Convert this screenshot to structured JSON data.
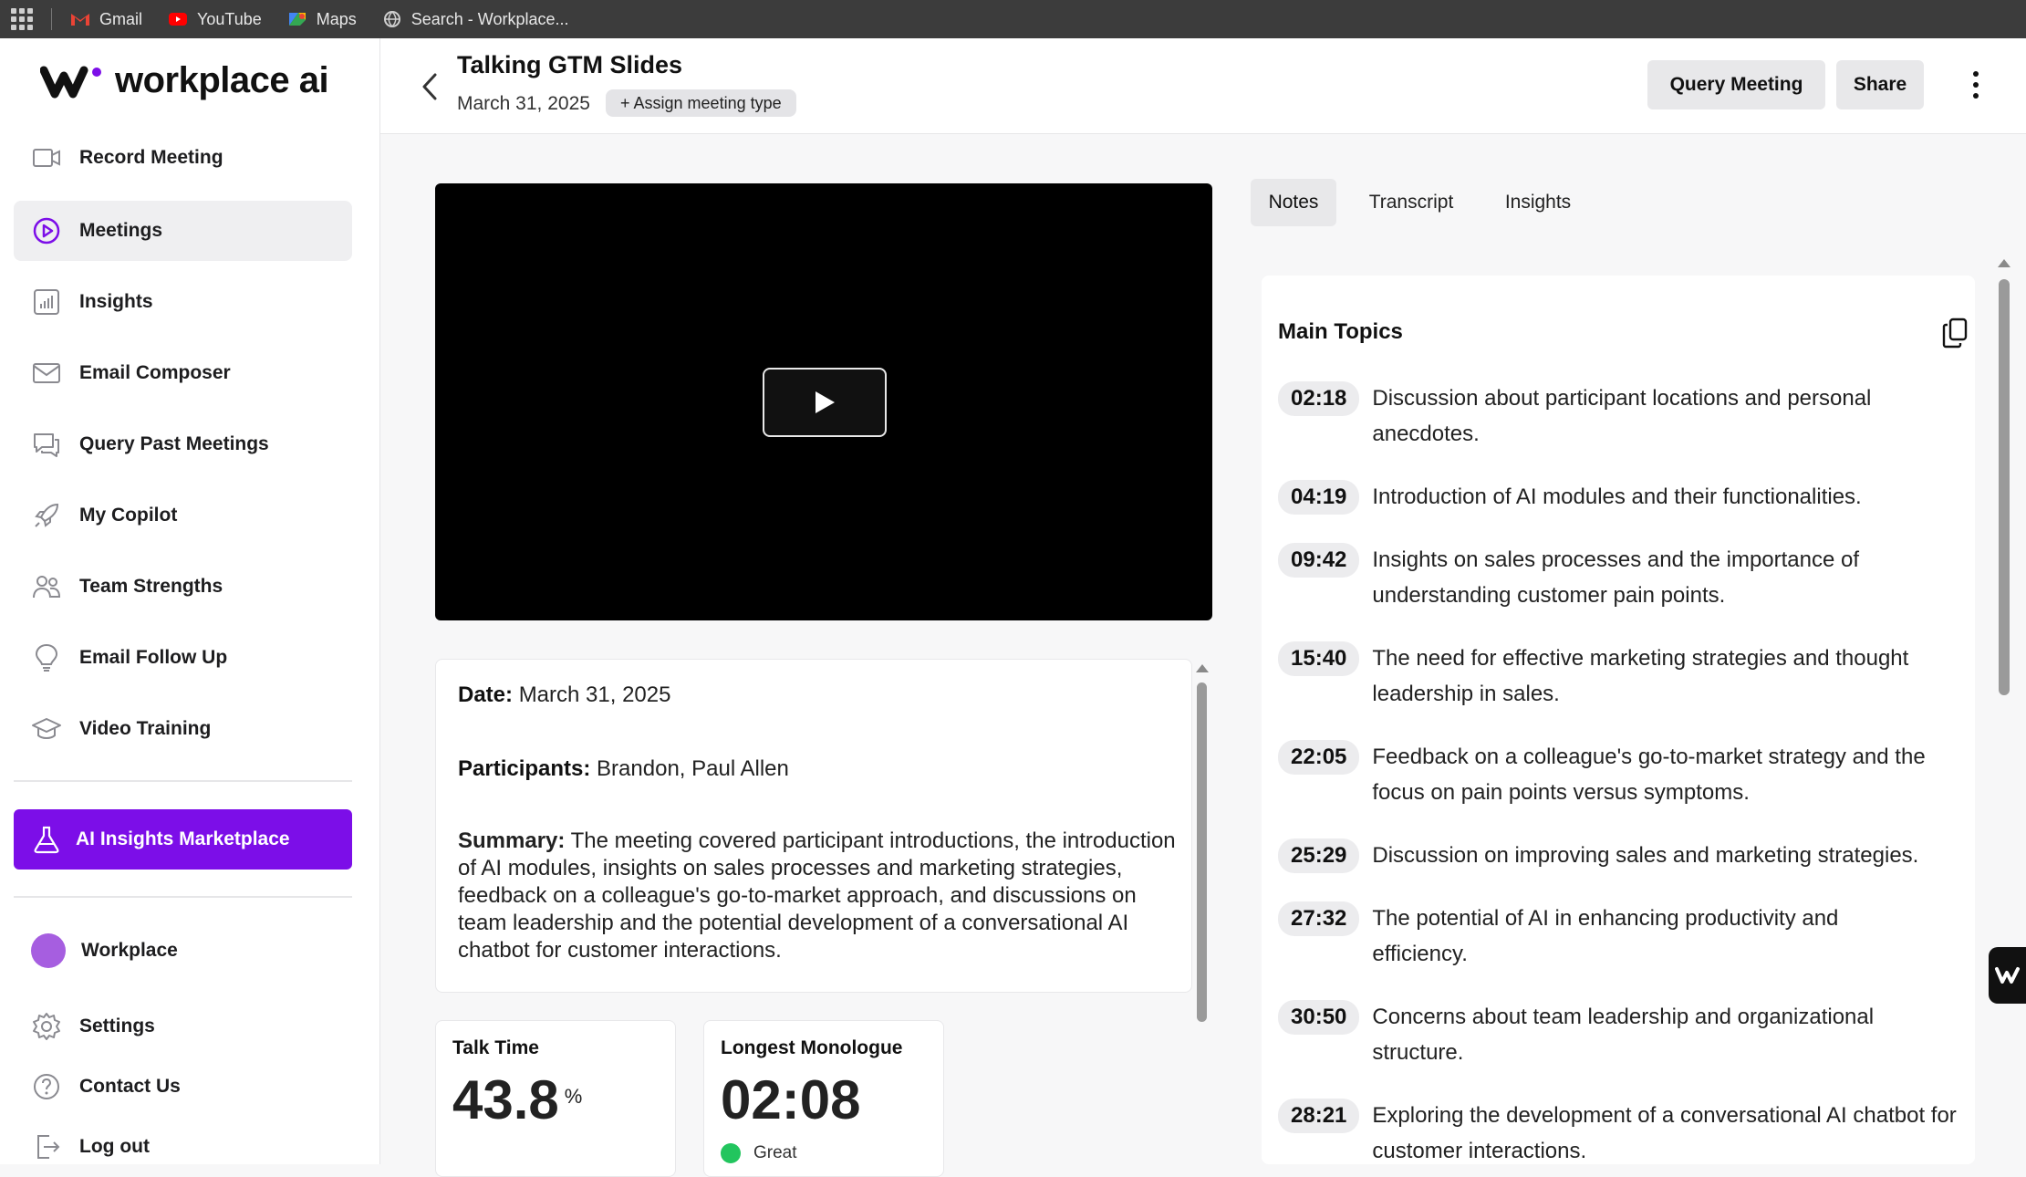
{
  "browser": {
    "bookmarks": [
      {
        "label": "Gmail",
        "icon": "gmail-icon",
        "color": "#ea4335"
      },
      {
        "label": "YouTube",
        "icon": "youtube-icon",
        "color": "#ff0000"
      },
      {
        "label": "Maps",
        "icon": "maps-icon",
        "color": "#34a853"
      },
      {
        "label": "Search - Workplace...",
        "icon": "globe-icon",
        "color": "#cfcfcf"
      }
    ]
  },
  "brand": {
    "name": "workplace ai",
    "accent": "#7c0ee8"
  },
  "sidebar": {
    "items": [
      {
        "label": "Record Meeting",
        "icon": "video-camera-icon"
      },
      {
        "label": "Meetings",
        "icon": "play-circle-icon",
        "active": true
      },
      {
        "label": "Insights",
        "icon": "bar-chart-icon"
      },
      {
        "label": "Email Composer",
        "icon": "envelope-icon"
      },
      {
        "label": "Query Past Meetings",
        "icon": "chat-bubbles-icon"
      },
      {
        "label": "My Copilot",
        "icon": "rocket-icon"
      },
      {
        "label": "Team Strengths",
        "icon": "people-icon"
      },
      {
        "label": "Email Follow Up",
        "icon": "lightbulb-icon"
      },
      {
        "label": "Video Training",
        "icon": "graduation-cap-icon"
      }
    ],
    "marketplace_label": "AI Insights Marketplace",
    "workspace_label": "Workplace",
    "settings_label": "Settings",
    "contact_label": "Contact Us",
    "logout_label": "Log out"
  },
  "header": {
    "title": "Talking GTM Slides",
    "date": "March 31, 2025",
    "assign_label": "+ Assign meeting type",
    "query_label": "Query Meeting",
    "share_label": "Share"
  },
  "meeting_info": {
    "date_label": "Date:",
    "date_value": "March 31, 2025",
    "participants_label": "Participants:",
    "participants_value": "Brandon, Paul Allen",
    "summary_label": "Summary:",
    "summary_value": "The meeting covered participant introductions, the introduction of AI modules, insights on sales processes and marketing strategies, feedback on a colleague's go-to-market approach, and discussions on team leadership and the potential development of a conversational AI chatbot for customer interactions."
  },
  "metrics": {
    "talk_time_label": "Talk Time",
    "talk_time_value": "43.8",
    "talk_time_unit": "%",
    "monologue_label": "Longest Monologue",
    "monologue_value": "02:08",
    "monologue_rating": "Great",
    "rating_color": "#22c55e"
  },
  "tabs": [
    {
      "label": "Notes",
      "active": true
    },
    {
      "label": "Transcript"
    },
    {
      "label": "Insights"
    }
  ],
  "topics": {
    "title": "Main Topics",
    "items": [
      {
        "time": "02:18",
        "text": "Discussion about participant locations and personal anecdotes."
      },
      {
        "time": "04:19",
        "text": "Introduction of AI modules and their functionalities."
      },
      {
        "time": "09:42",
        "text": "Insights on sales processes and the importance of understanding customer pain points."
      },
      {
        "time": "15:40",
        "text": "The need for effective marketing strategies and thought leadership in sales."
      },
      {
        "time": "22:05",
        "text": "Feedback on a colleague's go-to-market strategy and the focus on pain points versus symptoms."
      },
      {
        "time": "25:29",
        "text": "Discussion on improving sales and marketing strategies."
      },
      {
        "time": "27:32",
        "text": "The potential of AI in enhancing productivity and efficiency."
      },
      {
        "time": "30:50",
        "text": "Concerns about team leadership and organizational structure."
      },
      {
        "time": "28:21",
        "text": "Exploring the development of a conversational AI chatbot for customer interactions."
      }
    ]
  }
}
